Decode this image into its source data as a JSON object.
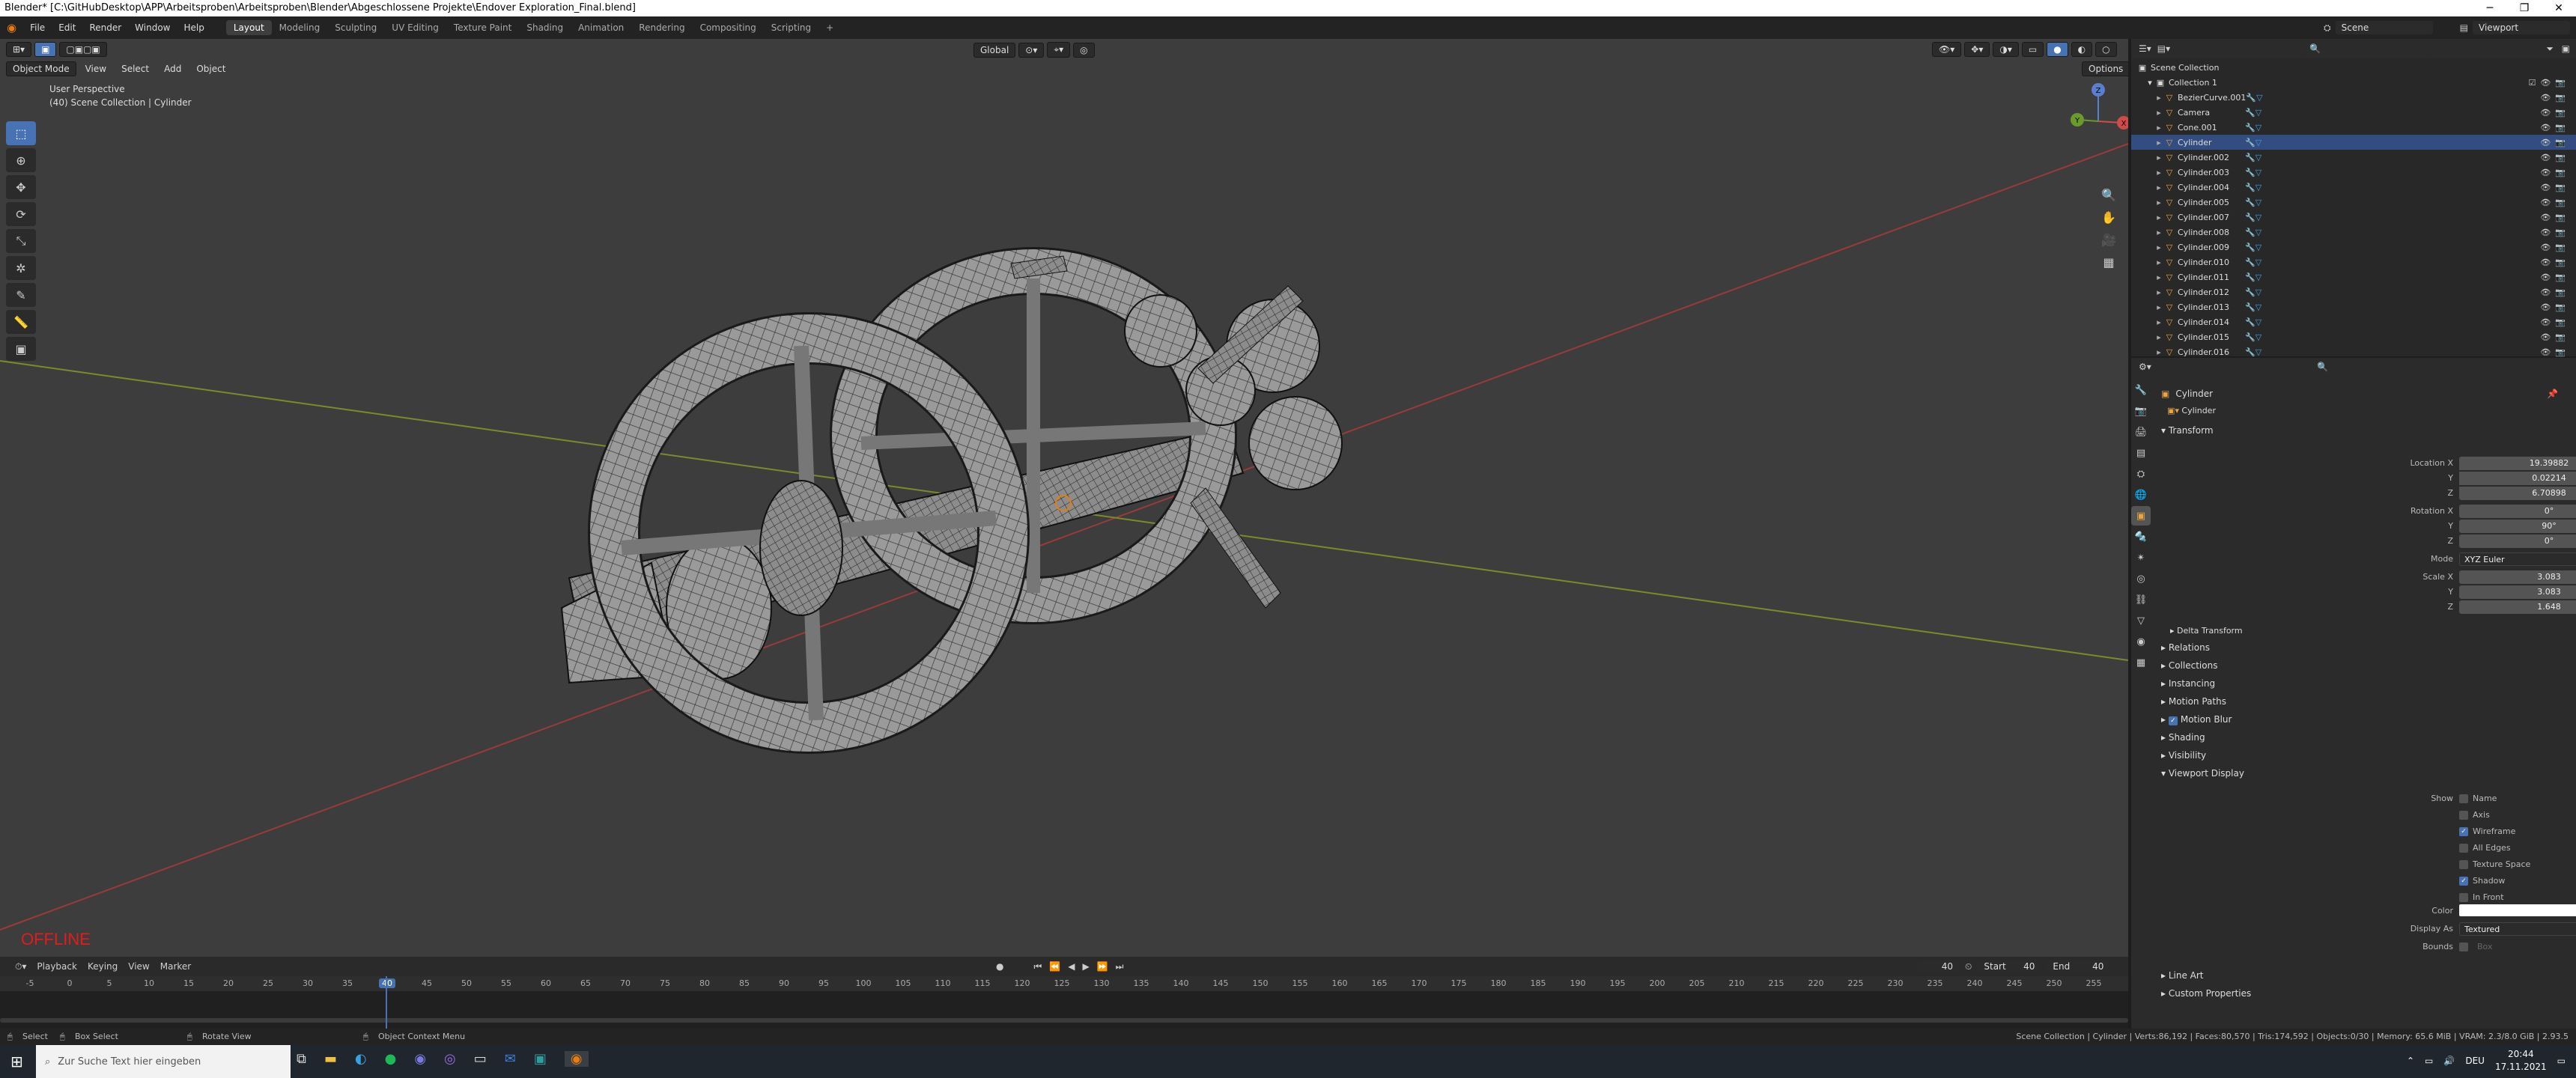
{
  "titlebar": {
    "title": "Blender* [C:\\GitHubDesktop\\APP\\Arbeitsproben\\Arbeitsproben\\Blender\\Abgeschlossene Projekte\\Endover Exploration_Final.blend]"
  },
  "topmenu": {
    "items": [
      "File",
      "Edit",
      "Render",
      "Window",
      "Help"
    ],
    "workspaces": [
      "Layout",
      "Modeling",
      "Sculpting",
      "UV Editing",
      "Texture Paint",
      "Shading",
      "Animation",
      "Rendering",
      "Compositing",
      "Scripting"
    ],
    "active_workspace": "Layout",
    "scene": "Scene",
    "view_layer": "Viewport"
  },
  "viewport": {
    "mode": "Object Mode",
    "menus": [
      "View",
      "Select",
      "Add",
      "Object"
    ],
    "transform_orientation": "Global",
    "options_label": "Options",
    "info_line1": "User Perspective",
    "info_line2": "(40) Scene Collection | Cylinder",
    "offline_label": "OFFLINE",
    "gizmo_axes": [
      "X",
      "Y",
      "Z"
    ]
  },
  "timeline": {
    "menus": [
      "Playback",
      "Keying",
      "View",
      "Marker"
    ],
    "current_frame": "40",
    "start_label": "Start",
    "start_value": "40",
    "end_label": "End",
    "end_value": "40",
    "ruler": [
      "-5",
      "0",
      "5",
      "10",
      "15",
      "20",
      "25",
      "30",
      "35",
      "40",
      "45",
      "50",
      "55",
      "60",
      "65",
      "70",
      "75",
      "80",
      "85",
      "90",
      "95",
      "100",
      "105",
      "110",
      "115",
      "120",
      "125",
      "130",
      "135",
      "140",
      "145",
      "150",
      "155",
      "160",
      "165",
      "170",
      "175",
      "180",
      "185",
      "190",
      "195",
      "200",
      "205",
      "210",
      "215",
      "220",
      "225",
      "230",
      "235",
      "240",
      "245",
      "250",
      "255"
    ]
  },
  "statusbar": {
    "select": "Select",
    "box_select": "Box Select",
    "rotate_view": "Rotate View",
    "context_menu": "Object Context Menu",
    "stats": "Scene Collection | Cylinder | Verts:86,192 | Faces:80,570 | Tris:174,592 | Objects:0/30 | Memory: 65.6 MiB | VRAM: 2.3/8.0 GiB | 2.93.5"
  },
  "taskbar": {
    "search_placeholder": "Zur Suche Text hier eingeben",
    "lang": "DEU",
    "time": "20:44",
    "date": "17.11.2021"
  },
  "outliner": {
    "root": "Scene Collection",
    "collection": "Collection 1",
    "items": [
      {
        "name": "BezierCurve.001",
        "icon": "curve-icon"
      },
      {
        "name": "Camera",
        "icon": "camera-icon"
      },
      {
        "name": "Cone.001",
        "icon": "mesh-icon"
      },
      {
        "name": "Cylinder",
        "icon": "mesh-icon"
      },
      {
        "name": "Cylinder.002",
        "icon": "mesh-icon"
      },
      {
        "name": "Cylinder.003",
        "icon": "mesh-icon"
      },
      {
        "name": "Cylinder.004",
        "icon": "mesh-icon"
      },
      {
        "name": "Cylinder.005",
        "icon": "mesh-icon"
      },
      {
        "name": "Cylinder.007",
        "icon": "mesh-icon"
      },
      {
        "name": "Cylinder.008",
        "icon": "mesh-icon"
      },
      {
        "name": "Cylinder.009",
        "icon": "mesh-icon"
      },
      {
        "name": "Cylinder.010",
        "icon": "mesh-icon"
      },
      {
        "name": "Cylinder.011",
        "icon": "mesh-icon"
      },
      {
        "name": "Cylinder.012",
        "icon": "mesh-icon"
      },
      {
        "name": "Cylinder.013",
        "icon": "mesh-icon"
      },
      {
        "name": "Cylinder.014",
        "icon": "mesh-icon"
      },
      {
        "name": "Cylinder.015",
        "icon": "mesh-icon"
      },
      {
        "name": "Cylinder.016",
        "icon": "mesh-icon"
      }
    ]
  },
  "properties": {
    "object_name": "Cylinder",
    "data_name": "Cylinder",
    "transform_label": "Transform",
    "location_label": "Location X",
    "location": [
      "19.39882",
      "0.02214",
      "6.70898"
    ],
    "rotation_label": "Rotation X",
    "rotation": [
      "0°",
      "90°",
      "0°"
    ],
    "mode_label": "Mode",
    "mode_value": "XYZ Euler",
    "scale_label": "Scale X",
    "scale": [
      "3.083",
      "3.083",
      "1.648"
    ],
    "axis_y": "Y",
    "axis_z": "Z",
    "delta_transform": "Delta Transform",
    "sections": [
      "Relations",
      "Collections",
      "Instancing",
      "Motion Paths",
      "Motion Blur",
      "Shading",
      "Visibility",
      "Viewport Display"
    ],
    "show_label": "Show",
    "show_options": [
      {
        "label": "Name",
        "checked": false
      },
      {
        "label": "Axis",
        "checked": false
      },
      {
        "label": "Wireframe",
        "checked": true
      },
      {
        "label": "All Edges",
        "checked": false
      },
      {
        "label": "Texture Space",
        "checked": false
      },
      {
        "label": "Shadow",
        "checked": true
      },
      {
        "label": "In Front",
        "checked": false
      }
    ],
    "color_label": "Color",
    "display_as_label": "Display As",
    "display_as_value": "Textured",
    "bounds_label": "Bounds",
    "bounds_value": "Box",
    "line_art": "Line Art",
    "custom_properties": "Custom Properties"
  }
}
